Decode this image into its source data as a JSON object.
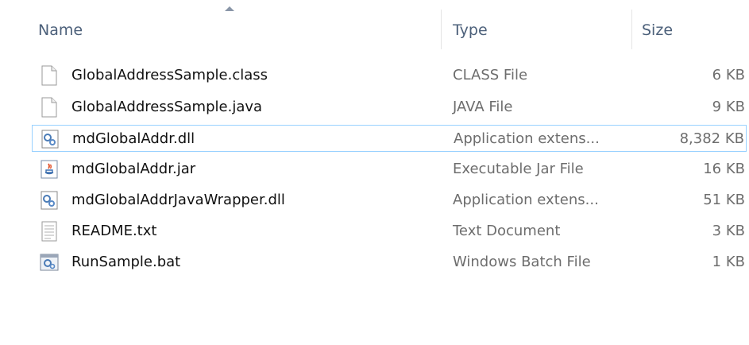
{
  "header": {
    "name_label": "Name",
    "type_label": "Type",
    "size_label": "Size"
  },
  "files": [
    {
      "name": "GlobalAddressSample.class",
      "type": "CLASS File",
      "size": "6 KB",
      "icon": "blank-file-icon"
    },
    {
      "name": "GlobalAddressSample.java",
      "type": "JAVA File",
      "size": "9 KB",
      "icon": "blank-file-icon"
    },
    {
      "name": "mdGlobalAddr.dll",
      "type": "Application extens...",
      "size": "8,382 KB",
      "icon": "dll-gear-icon"
    },
    {
      "name": "mdGlobalAddr.jar",
      "type": "Executable Jar File",
      "size": "16 KB",
      "icon": "java-jar-icon"
    },
    {
      "name": "mdGlobalAddrJavaWrapper.dll",
      "type": "Application extens...",
      "size": "51 KB",
      "icon": "dll-gear-icon"
    },
    {
      "name": "README.txt",
      "type": "Text Document",
      "size": "3 KB",
      "icon": "text-document-icon"
    },
    {
      "name": "RunSample.bat",
      "type": "Windows Batch File",
      "size": "1 KB",
      "icon": "batch-file-icon"
    }
  ],
  "focused_index": 2,
  "colors": {
    "header_text": "#4c607a",
    "focus_border": "#99d1ff",
    "secondary_text": "#6d6d6d"
  }
}
